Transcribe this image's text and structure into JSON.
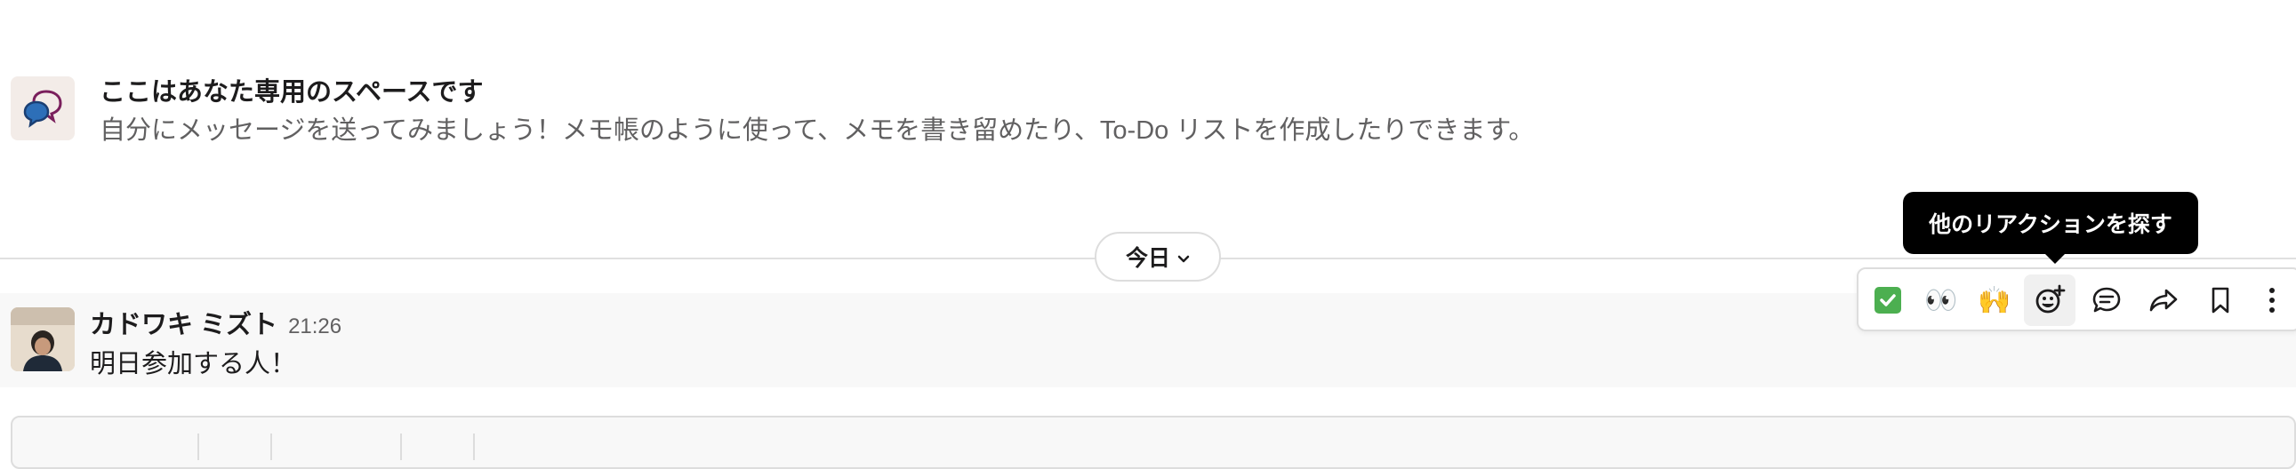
{
  "intro": {
    "title": "ここはあなた専用のスペースです",
    "subtitle": "自分にメッセージを送ってみましょう！メモ帳のように使って、メモを書き留めたり、To-Do リストを作成したりできます。"
  },
  "divider": {
    "date_label": "今日"
  },
  "message": {
    "author": "カドワキ ミズト",
    "time": "21:26",
    "text": "明日参加する人！"
  },
  "toolbar": {
    "reactions": [
      "white-check-mark",
      "eyes",
      "raised-hands"
    ],
    "eyes_emoji": "👀",
    "hands_emoji": "🙌",
    "tooltip": "他のリアクションを探す"
  },
  "colors": {
    "check_green": "#4caf50",
    "tooltip_bg": "#000000",
    "hover_row": "#f8f8f8"
  }
}
